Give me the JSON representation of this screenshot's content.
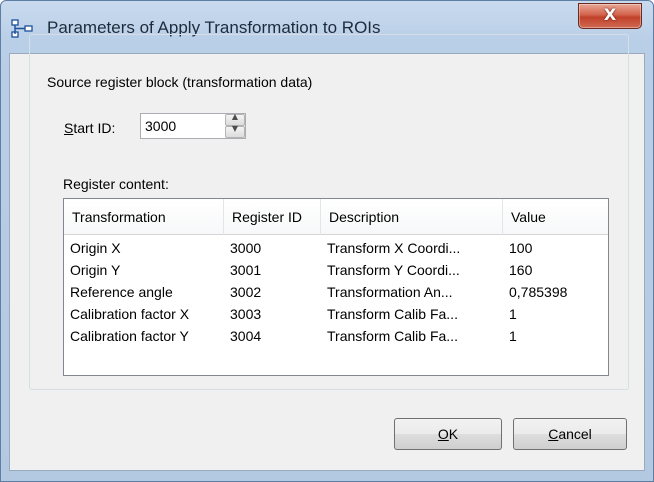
{
  "window": {
    "title": "Parameters of Apply Transformation to ROIs",
    "close_glyph": "X"
  },
  "group": {
    "legend": "Source register block (transformation data)"
  },
  "start_id": {
    "label_accel": "S",
    "label_rest": "tart ID:",
    "value": "3000"
  },
  "register": {
    "label": "Register content:",
    "columns": [
      "Transformation",
      "Register ID",
      "Description",
      "Value"
    ],
    "rows": [
      [
        "Origin X",
        "3000",
        "Transform X Coordi...",
        "100"
      ],
      [
        "Origin Y",
        "3001",
        "Transform Y Coordi...",
        "160"
      ],
      [
        "Reference angle",
        "3002",
        "Transformation An...",
        "0,785398"
      ],
      [
        "Calibration factor X",
        "3003",
        "Transform Calib Fa...",
        "1"
      ],
      [
        "Calibration factor Y",
        "3004",
        "Transform Calib Fa...",
        "1"
      ]
    ]
  },
  "buttons": {
    "ok_accel": "O",
    "ok_rest": "K",
    "cancel_accel": "C",
    "cancel_rest": "ancel"
  },
  "icons": {
    "app": "register-block-icon",
    "close": "close-icon",
    "spin_up": "spin-up-icon",
    "spin_down": "spin-down-icon"
  }
}
